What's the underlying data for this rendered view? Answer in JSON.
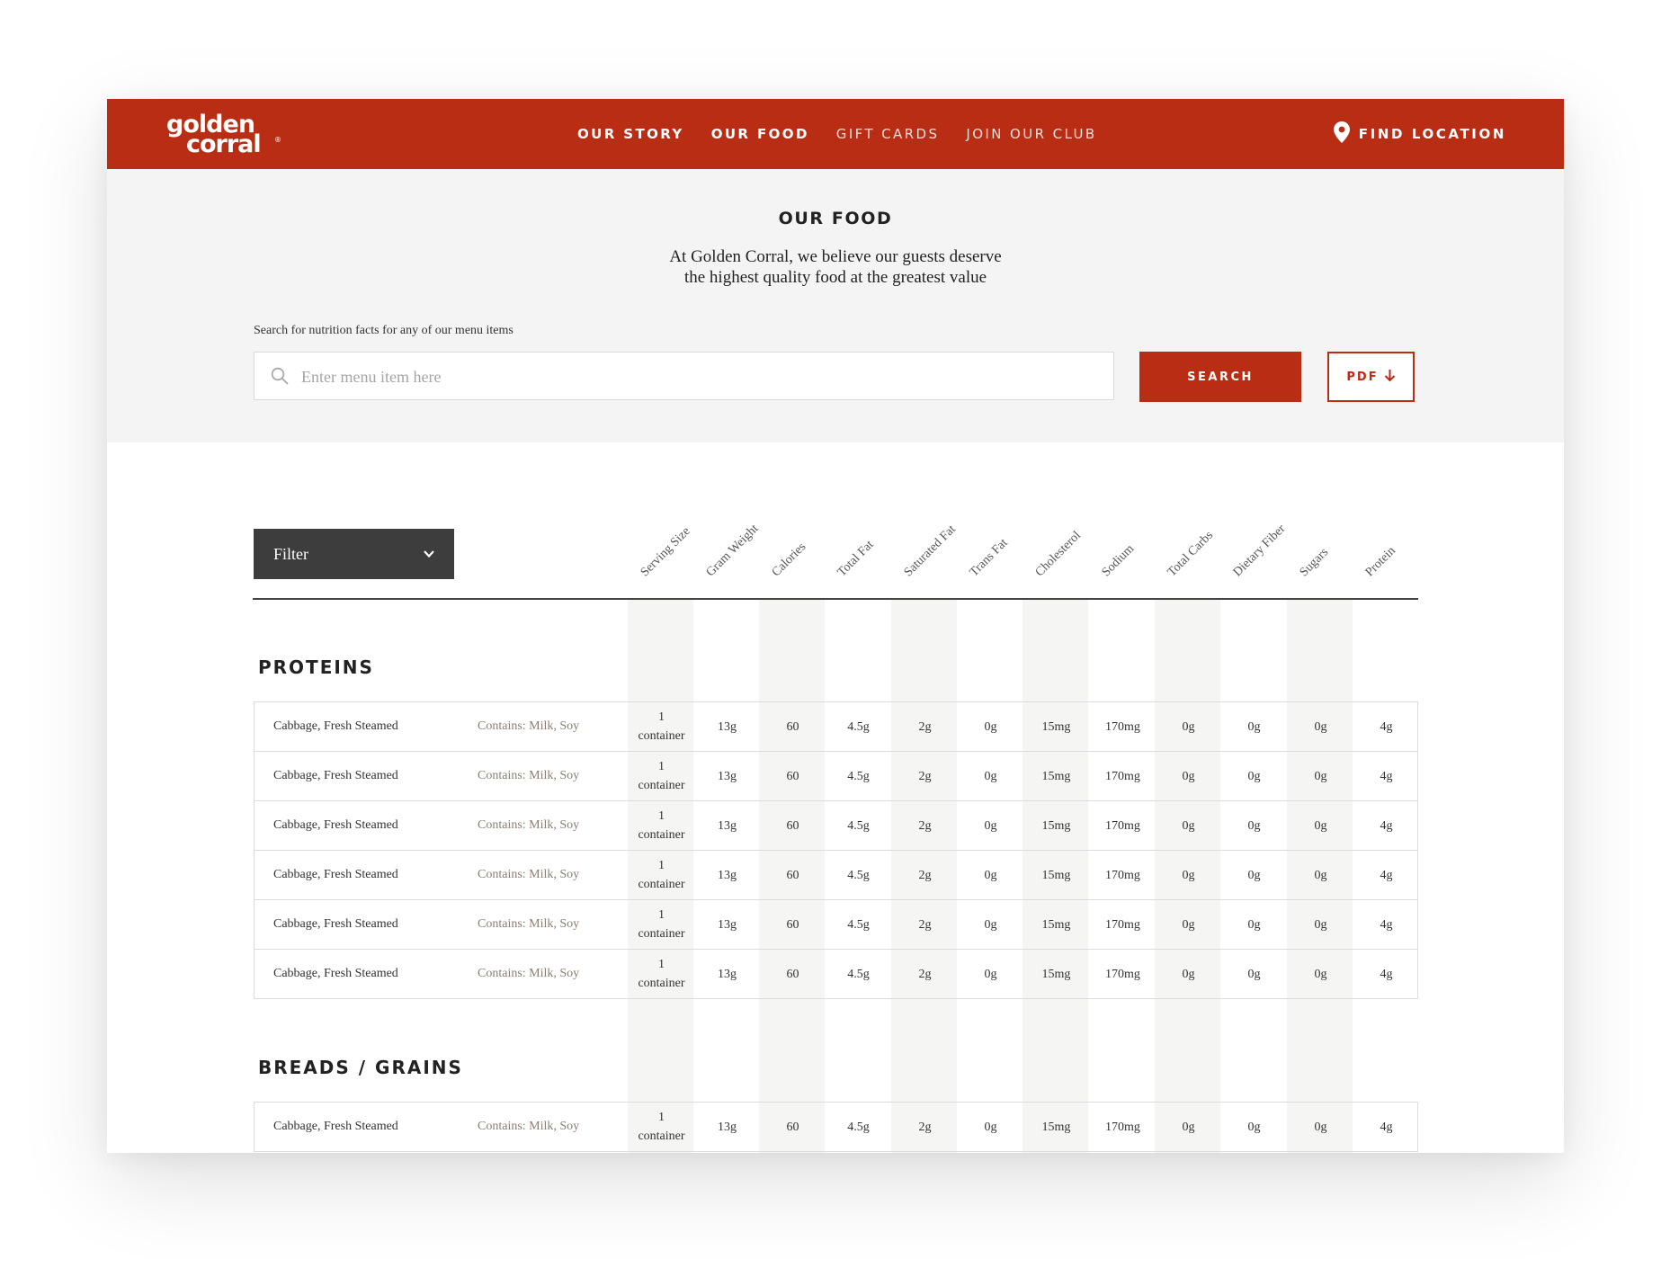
{
  "brand": {
    "line1": "golden",
    "line2": "corral",
    "reg": "®"
  },
  "nav": {
    "items": [
      {
        "label": "OUR STORY",
        "name": "nav-our-story",
        "style": "bold"
      },
      {
        "label": "OUR FOOD",
        "name": "nav-our-food",
        "style": "bold"
      },
      {
        "label": "GIFT CARDS",
        "name": "nav-gift-cards",
        "style": "light"
      },
      {
        "label": "JOIN OUR CLUB",
        "name": "nav-join-our-club",
        "style": "light"
      }
    ],
    "find_location": "FIND LOCATION"
  },
  "hero": {
    "title": "OUR FOOD",
    "subtitle_line1": "At Golden Corral, we believe our guests deserve",
    "subtitle_line2": "the highest quality food at the greatest value"
  },
  "search": {
    "label": "Search for nutrition facts for any of our menu items",
    "placeholder": "Enter menu item here",
    "value": "",
    "button": "SEARCH",
    "pdf_button": "PDF"
  },
  "filter": {
    "label": "Filter"
  },
  "columns": [
    "Serving Size",
    "Gram Weight",
    "Calories",
    "Total Fat",
    "Saturated Fat",
    "Trans Fat",
    "Cholesterol",
    "Sodium",
    "Total Carbs",
    "Dietary Fiber",
    "Sugars",
    "Protein"
  ],
  "sections": [
    {
      "title": "PROTEINS",
      "rows": [
        {
          "name": "Cabbage, Fresh Steamed",
          "allergens": "Contains: Milk, Soy",
          "serving_qty": "1",
          "serving_unit": "container",
          "values": [
            "13g",
            "60",
            "4.5g",
            "2g",
            "0g",
            "15mg",
            "170mg",
            "0g",
            "0g",
            "0g",
            "4g"
          ]
        },
        {
          "name": "Cabbage, Fresh Steamed",
          "allergens": "Contains: Milk, Soy",
          "serving_qty": "1",
          "serving_unit": "container",
          "values": [
            "13g",
            "60",
            "4.5g",
            "2g",
            "0g",
            "15mg",
            "170mg",
            "0g",
            "0g",
            "0g",
            "4g"
          ]
        },
        {
          "name": "Cabbage, Fresh Steamed",
          "allergens": "Contains: Milk, Soy",
          "serving_qty": "1",
          "serving_unit": "container",
          "values": [
            "13g",
            "60",
            "4.5g",
            "2g",
            "0g",
            "15mg",
            "170mg",
            "0g",
            "0g",
            "0g",
            "4g"
          ]
        },
        {
          "name": "Cabbage, Fresh Steamed",
          "allergens": "Contains: Milk, Soy",
          "serving_qty": "1",
          "serving_unit": "container",
          "values": [
            "13g",
            "60",
            "4.5g",
            "2g",
            "0g",
            "15mg",
            "170mg",
            "0g",
            "0g",
            "0g",
            "4g"
          ]
        },
        {
          "name": "Cabbage, Fresh Steamed",
          "allergens": "Contains: Milk, Soy",
          "serving_qty": "1",
          "serving_unit": "container",
          "values": [
            "13g",
            "60",
            "4.5g",
            "2g",
            "0g",
            "15mg",
            "170mg",
            "0g",
            "0g",
            "0g",
            "4g"
          ]
        },
        {
          "name": "Cabbage, Fresh Steamed",
          "allergens": "Contains: Milk, Soy",
          "serving_qty": "1",
          "serving_unit": "container",
          "values": [
            "13g",
            "60",
            "4.5g",
            "2g",
            "0g",
            "15mg",
            "170mg",
            "0g",
            "0g",
            "0g",
            "4g"
          ]
        }
      ]
    },
    {
      "title": "BREADS / GRAINS",
      "rows": [
        {
          "name": "Cabbage, Fresh Steamed",
          "allergens": "Contains: Milk, Soy",
          "serving_qty": "1",
          "serving_unit": "container",
          "values": [
            "13g",
            "60",
            "4.5g",
            "2g",
            "0g",
            "15mg",
            "170mg",
            "0g",
            "0g",
            "0g",
            "4g"
          ]
        }
      ]
    }
  ],
  "colors": {
    "brand_red": "#b82d13",
    "filter_dark": "#3d3d3d",
    "hero_bg": "#f4f4f4",
    "allergen_text": "#8a7e74"
  },
  "icons": [
    "location-pin-icon",
    "search-icon",
    "arrow-down-icon",
    "chevron-down-icon"
  ]
}
